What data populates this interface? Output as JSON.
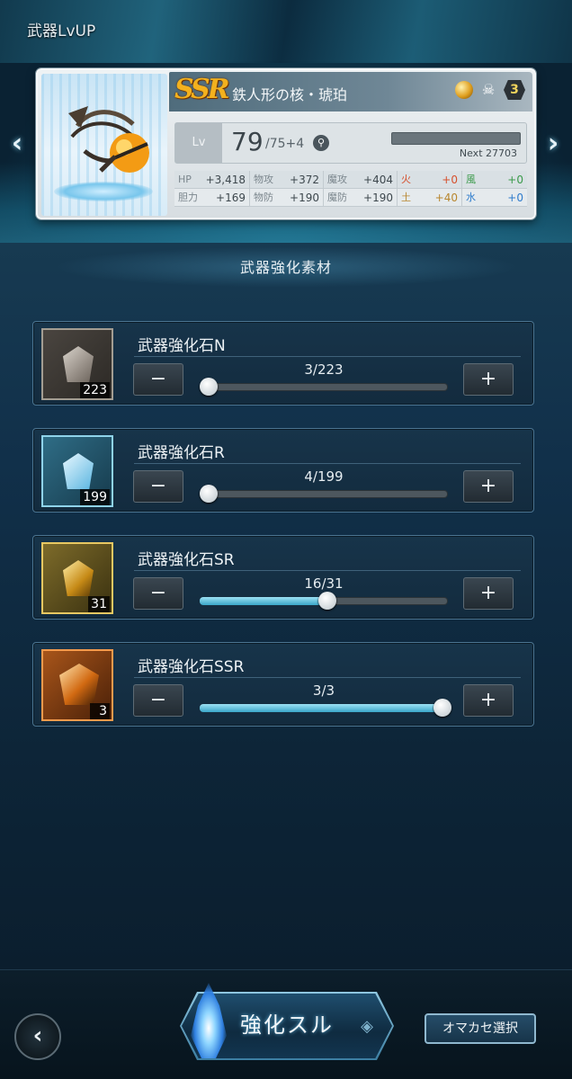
{
  "header": {
    "title": "武器LvUP"
  },
  "weapon": {
    "rarity": "SSR",
    "name": "鉄人形の核・琥珀",
    "uncap_level": "3",
    "lv_label": "Lv",
    "level": "79",
    "level_cap": "/75+4",
    "next_exp": "Next 27703",
    "stats_row1": [
      {
        "key": "HP",
        "value": "+3,418"
      },
      {
        "key": "物攻",
        "value": "+372"
      },
      {
        "key": "魔攻",
        "value": "+404"
      },
      {
        "key": "火",
        "value": "+0"
      },
      {
        "key": "風",
        "value": "+0"
      }
    ],
    "stats_row2": [
      {
        "key": "胆力",
        "value": "+169"
      },
      {
        "key": "物防",
        "value": "+190"
      },
      {
        "key": "魔防",
        "value": "+190"
      },
      {
        "key": "土",
        "value": "+40"
      },
      {
        "key": "水",
        "value": "+0"
      }
    ]
  },
  "materials_section": {
    "title": "武器強化素材",
    "items": [
      {
        "name": "武器強化石N",
        "owned": "223",
        "quantity_text": "3/223",
        "selected": 3,
        "max": 223
      },
      {
        "name": "武器強化石R",
        "owned": "199",
        "quantity_text": "4/199",
        "selected": 4,
        "max": 199
      },
      {
        "name": "武器強化石SR",
        "owned": "31",
        "quantity_text": "16/31",
        "selected": 16,
        "max": 31
      },
      {
        "name": "武器強化石SSR",
        "owned": "3",
        "quantity_text": "3/3",
        "selected": 3,
        "max": 3
      }
    ],
    "minus_label": "−",
    "plus_label": "+"
  },
  "footer": {
    "enhance_label": "強化スル",
    "auto_select_label": "オマカセ選択"
  },
  "icons": {
    "prev": "chevron-left-icon",
    "next": "chevron-right-icon",
    "back": "back-arrow-icon",
    "search": "search-icon"
  }
}
